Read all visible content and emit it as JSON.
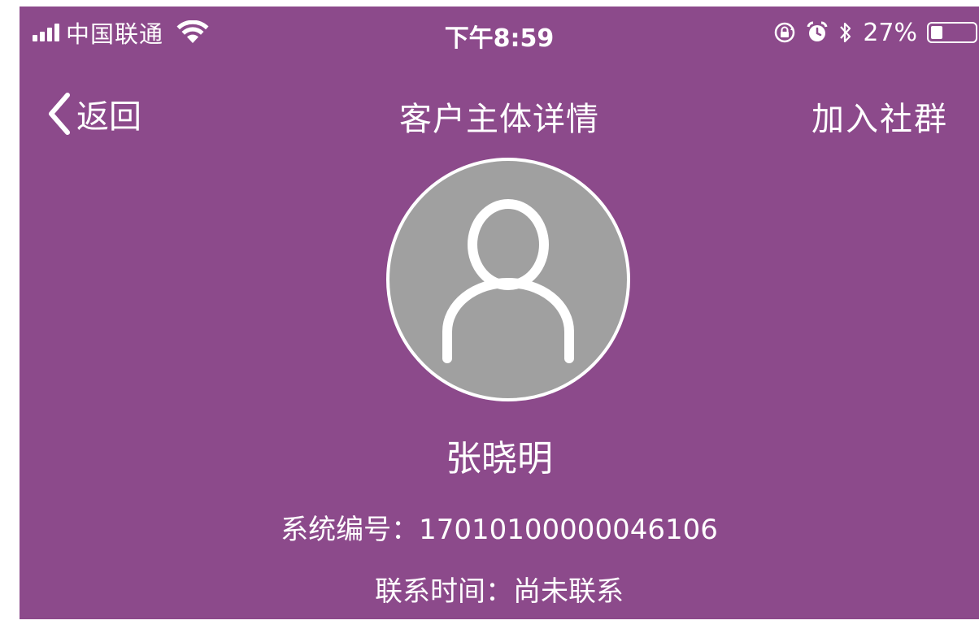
{
  "status_bar": {
    "carrier": "中国联通",
    "time": "下午8:59",
    "battery": "27%",
    "battery_level": 0.27,
    "icons": [
      "signal-icon",
      "wifi-icon",
      "orientation-lock-icon",
      "alarm-icon",
      "bluetooth-icon",
      "battery-icon"
    ]
  },
  "nav": {
    "back_label": "返回",
    "title": "客户主体详情",
    "action_label": "加入社群"
  },
  "profile": {
    "avatar_icon": "person-icon",
    "name": "张晓明",
    "system_id_line": "系统编号：17010100000046106",
    "contact_time_line": "联系时间：尚未联系"
  },
  "colors": {
    "background": "#8c4a8b",
    "avatar_background": "#a0a0a0",
    "text": "#ffffff"
  }
}
